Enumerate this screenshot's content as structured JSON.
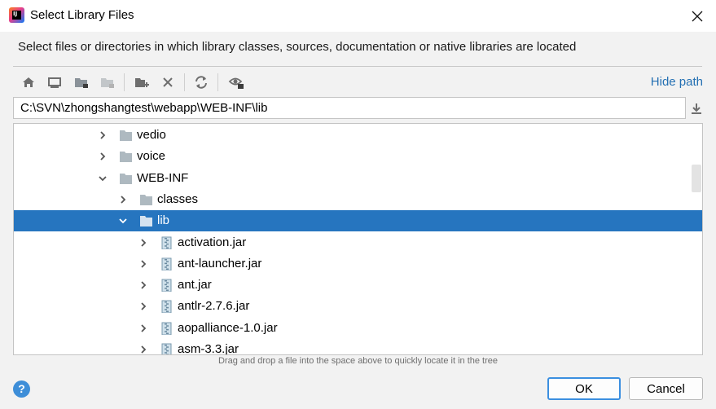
{
  "window": {
    "title": "Select Library Files",
    "close_icon": "close-icon"
  },
  "description": "Select files or directories in which library classes, sources, documentation or native libraries are located",
  "toolbar": {
    "buttons": [
      "home-icon",
      "desktop-icon",
      "project-folder-icon",
      "module-folder-icon",
      "new-folder-icon",
      "delete-icon",
      "refresh-icon",
      "show-hidden-icon"
    ],
    "hide_path_label": "Hide path"
  },
  "path_field": {
    "value": "C:\\SVN\\zhongshangtest\\webapp\\WEB-INF\\lib"
  },
  "tree": {
    "rows": [
      {
        "label": "vedio",
        "type": "folder",
        "expanded": false,
        "depth": 0
      },
      {
        "label": "voice",
        "type": "folder",
        "expanded": false,
        "depth": 0
      },
      {
        "label": "WEB-INF",
        "type": "folder",
        "expanded": true,
        "depth": 0
      },
      {
        "label": "classes",
        "type": "folder",
        "expanded": false,
        "depth": 1
      },
      {
        "label": "lib",
        "type": "folder",
        "expanded": true,
        "depth": 1,
        "selected": true
      },
      {
        "label": "activation.jar",
        "type": "jar",
        "expanded": false,
        "depth": 2
      },
      {
        "label": "ant-launcher.jar",
        "type": "jar",
        "expanded": false,
        "depth": 2
      },
      {
        "label": "ant.jar",
        "type": "jar",
        "expanded": false,
        "depth": 2
      },
      {
        "label": "antlr-2.7.6.jar",
        "type": "jar",
        "expanded": false,
        "depth": 2
      },
      {
        "label": "aopalliance-1.0.jar",
        "type": "jar",
        "expanded": false,
        "depth": 2
      },
      {
        "label": "asm-3.3.jar",
        "type": "jar",
        "expanded": false,
        "depth": 2
      }
    ]
  },
  "hint": "Drag and drop a file into the space above to quickly locate it in the tree",
  "footer": {
    "help_label": "?",
    "ok_label": "OK",
    "cancel_label": "Cancel"
  },
  "colors": {
    "selection": "#2675bf",
    "link": "#2470b3",
    "folder": "#aeb9c0",
    "default_button_border": "#3b8fe0"
  }
}
